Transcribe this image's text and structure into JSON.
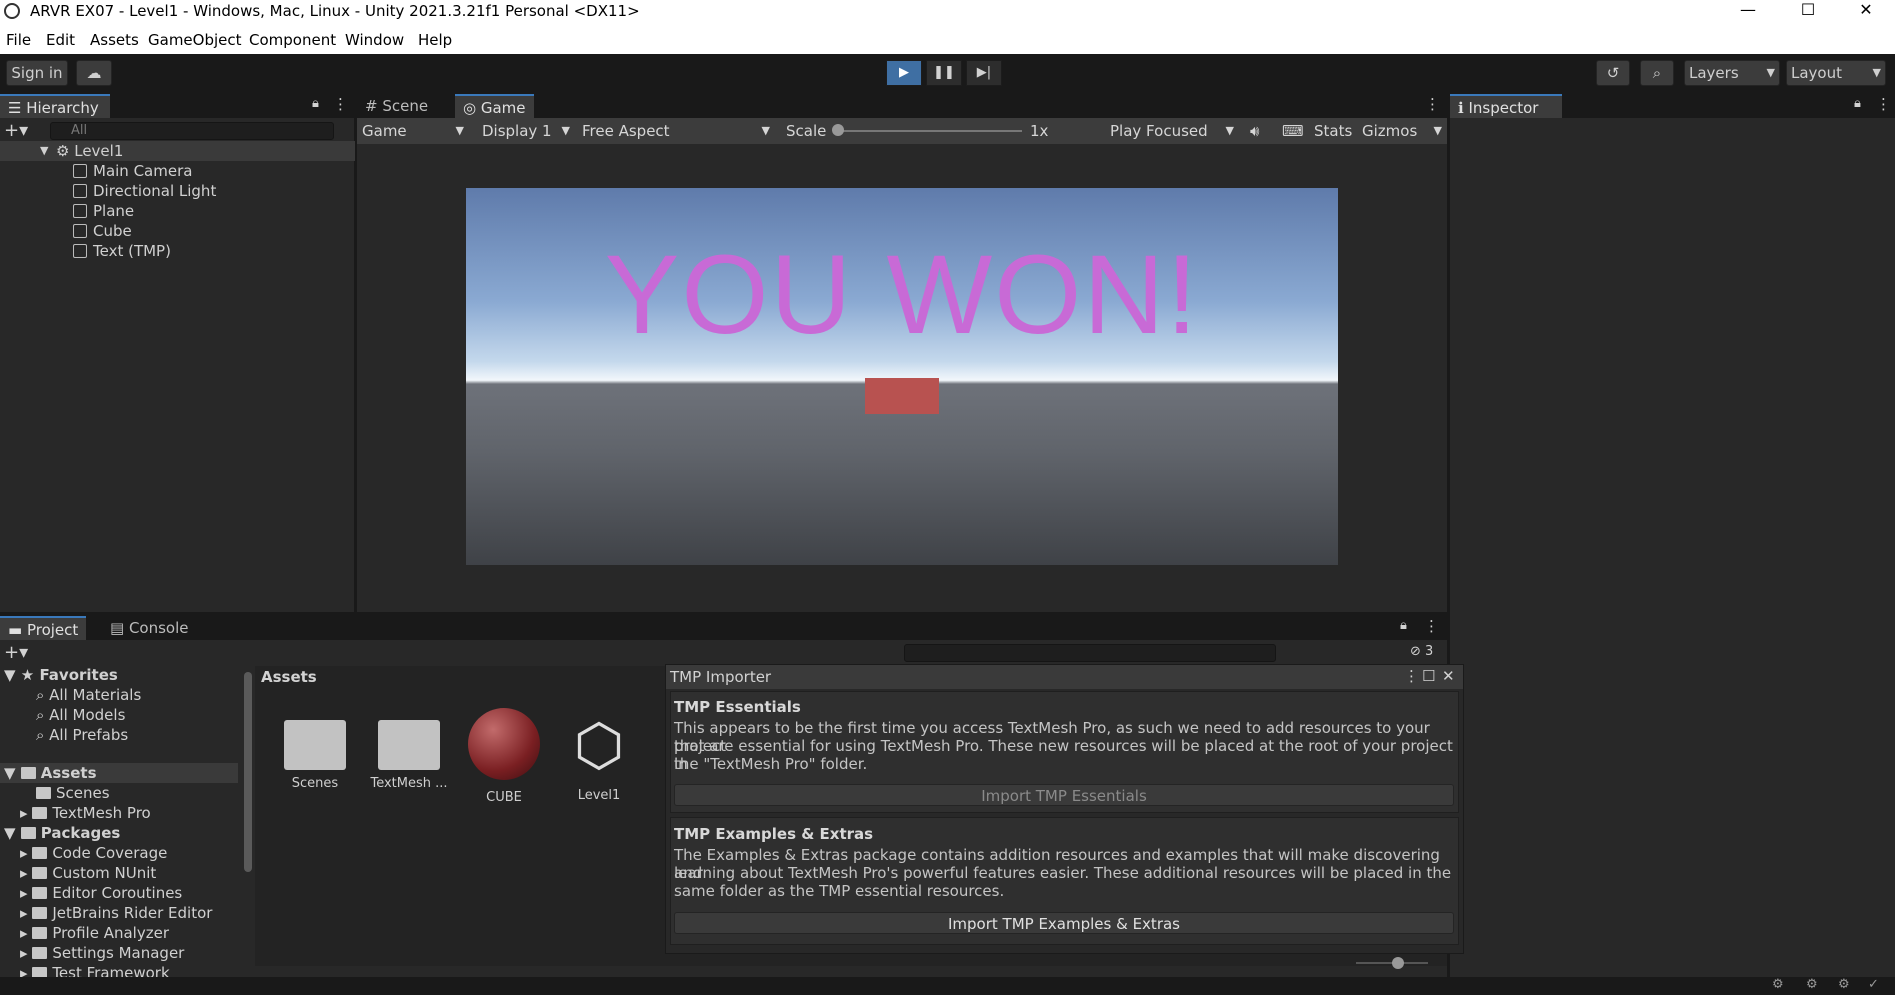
{
  "window": {
    "title": "ARVR EX07 - Level1 - Windows, Mac, Linux - Unity 2021.3.21f1 Personal <DX11>",
    "minimize": "—",
    "maximize": "☐",
    "close": "✕"
  },
  "menu": [
    "File",
    "Edit",
    "Assets",
    "GameObject",
    "Component",
    "Window",
    "Help"
  ],
  "toolbar": {
    "signin": "Sign in",
    "layers": "Layers",
    "layout": "Layout",
    "play_state": "playing"
  },
  "hierarchy": {
    "tab": "Hierarchy",
    "search_placeholder": "All",
    "scene": "Level1",
    "items": [
      "Main Camera",
      "Directional Light",
      "Plane",
      "Cube",
      "Text (TMP)"
    ]
  },
  "game_tabs": {
    "scene": "Scene",
    "game": "Game"
  },
  "game_toolbar": {
    "mode": "Game",
    "display": "Display 1",
    "aspect": "Free Aspect",
    "scale_label": "Scale",
    "scale_value": "1x",
    "play_focused": "Play Focused",
    "stats": "Stats",
    "gizmos": "Gizmos"
  },
  "game_view": {
    "text": "YOU WON!"
  },
  "inspector": {
    "tab": "Inspector"
  },
  "project": {
    "tab_project": "Project",
    "tab_console": "Console",
    "favorites_label": "Favorites",
    "favorites": [
      "All Materials",
      "All Models",
      "All Prefabs"
    ],
    "assets_label": "Assets",
    "assets_folders": [
      "Scenes",
      "TextMesh Pro"
    ],
    "packages_label": "Packages",
    "packages": [
      "Code Coverage",
      "Custom NUnit",
      "Editor Coroutines",
      "JetBrains Rider Editor",
      "Profile Analyzer",
      "Settings Manager",
      "Test Framework"
    ],
    "breadcrumb": "Assets",
    "assets": [
      "Scenes",
      "TextMesh ...",
      "CUBE",
      "Level1"
    ],
    "hidden_count": "3"
  },
  "tmp_importer": {
    "title": "TMP Importer",
    "essentials_heading": "TMP Essentials",
    "essentials_text_1": "This appears to be the first time you access TextMesh Pro, as such we need to add resources to your project",
    "essentials_text_2": "that are essential for using TextMesh Pro. These new resources will be placed at the root of your project in",
    "essentials_text_3": "the \"TextMesh Pro\" folder.",
    "essentials_button": "Import TMP Essentials",
    "extras_heading": "TMP Examples & Extras",
    "extras_text_1": "The Examples & Extras package contains addition resources and examples that will make discovering and",
    "extras_text_2": "learning about TextMesh Pro's powerful features easier. These additional resources will be placed in the",
    "extras_text_3": "same folder as the TMP essential resources.",
    "extras_button": "Import TMP Examples & Extras"
  },
  "colors": {
    "accent": "#3a79bb",
    "won_text": "#c86ad6",
    "cube": "#b85250"
  }
}
